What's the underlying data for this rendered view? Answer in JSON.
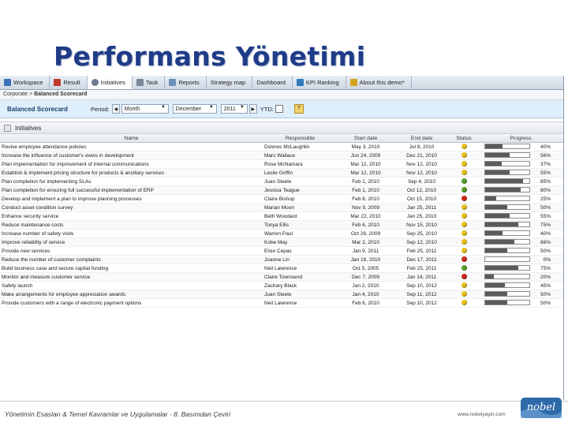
{
  "slide_title": "Performans Yönetimi",
  "tabs": [
    {
      "label": "Workspace",
      "active": false,
      "icon": "workspace-icon",
      "color": "#3b6fb6"
    },
    {
      "label": "Result",
      "active": false,
      "icon": "chart-icon",
      "color": "#c0392b"
    },
    {
      "label": "Initiatives",
      "active": true,
      "icon": "gear-icon",
      "color": "#6b7d8f"
    },
    {
      "label": "Task",
      "active": false,
      "icon": "task-icon",
      "color": "#7a8899"
    },
    {
      "label": "Reports",
      "active": false,
      "icon": "report-icon",
      "color": "#6b8fb5"
    },
    {
      "label": "Strategy map",
      "active": false,
      "icon": "",
      "color": ""
    },
    {
      "label": "Dashboard",
      "active": false,
      "icon": "",
      "color": ""
    },
    {
      "label": "KPI Ranking",
      "active": false,
      "icon": "ranking-icon",
      "color": "#2e7bbd"
    },
    {
      "label": "About this demo*",
      "active": false,
      "icon": "star-icon",
      "color": "#d5a21c"
    }
  ],
  "breadcrumb": {
    "parent": "Corporate > ",
    "current": "Balanced Scorecard"
  },
  "filters": {
    "title": "Balanced Scorecard",
    "period_label": "Period:",
    "period_value": "Month",
    "month_value": "December",
    "year_value": "2011",
    "ytd_label": "YTD:"
  },
  "section_title": "Initiatives",
  "columns": [
    "Name",
    "Responsible",
    "Start date",
    "End date",
    "Status",
    "Progress"
  ],
  "status_colors": {
    "yellow": "#e8c21a",
    "green": "#5aa02c",
    "red": "#d2291e"
  },
  "rows": [
    {
      "name": "Revise employee attendance policies",
      "responsible": "Dolores McLaughlin",
      "start": "May 3, 2010",
      "end": "Jul 8, 2010",
      "status": "yellow",
      "progress": 40
    },
    {
      "name": "Increase the influence of customer's views in development",
      "responsible": "Marc Wallace",
      "start": "Jun 24, 2009",
      "end": "Dec 21, 2010",
      "status": "yellow",
      "progress": 56
    },
    {
      "name": "Plan implementation for improvement of internal communications",
      "responsible": "Rose McNamara",
      "start": "Mar 12, 2010",
      "end": "Nov 12, 2010",
      "status": "yellow",
      "progress": 37
    },
    {
      "name": "Establish & implement pricing structure for products & ancillary services",
      "responsible": "Leslie Griffin",
      "start": "Mar 12, 2010",
      "end": "Nov 12, 2010",
      "status": "yellow",
      "progress": 55
    },
    {
      "name": "Plan completion for implementing SLAs",
      "responsible": "Juan Steele",
      "start": "Feb 1, 2010",
      "end": "Sep 4, 2010",
      "status": "green",
      "progress": 85
    },
    {
      "name": "Plan completion for ensuring full successful implementation of ERP",
      "responsible": "Jessica Teague",
      "start": "Feb 1, 2010",
      "end": "Oct 12, 2010",
      "status": "green",
      "progress": 80
    },
    {
      "name": "Develop and implement a plan to improve planning processes",
      "responsible": "Claire Bishop",
      "start": "Feb 8, 2010",
      "end": "Oct 15, 2010",
      "status": "red",
      "progress": 25
    },
    {
      "name": "Conduct asset condition survey",
      "responsible": "Marian Moon",
      "start": "Nov 9, 2009",
      "end": "Jan 25, 2011",
      "status": "yellow",
      "progress": 50
    },
    {
      "name": "Enhance security service",
      "responsible": "Beth Woodard",
      "start": "Mar 22, 2010",
      "end": "Jan 25, 2010",
      "status": "yellow",
      "progress": 55
    },
    {
      "name": "Reduce maintenance costs",
      "responsible": "Tonya Ellis",
      "start": "Feb 6, 2010",
      "end": "Nov 15, 2010",
      "status": "yellow",
      "progress": 75
    },
    {
      "name": "Increase number of safety visits",
      "responsible": "Warren Paul",
      "start": "Oct 26, 2009",
      "end": "Sep 25, 2010",
      "status": "yellow",
      "progress": 40
    },
    {
      "name": "Improve reliability of service",
      "responsible": "Kobe May",
      "start": "Mar 2, 2010",
      "end": "Sep 12, 2010",
      "status": "yellow",
      "progress": 66
    },
    {
      "name": "Provide new services",
      "responsible": "Elsie Cepas",
      "start": "Jan 9, 2011",
      "end": "Feb 25, 2011",
      "status": "yellow",
      "progress": 50
    },
    {
      "name": "Reduce the number of customer complaints",
      "responsible": "Joanne Lin",
      "start": "Jan 18, 2010",
      "end": "Dec 17, 2011",
      "status": "red",
      "progress": 0
    },
    {
      "name": "Build business case and secure capital funding",
      "responsible": "Neil Lawrence",
      "start": "Oct 5, 2005",
      "end": "Feb 25, 2011",
      "status": "green",
      "progress": 75
    },
    {
      "name": "Monitor and measure customer service",
      "responsible": "Claire Townsend",
      "start": "Dec 7, 2009",
      "end": "Jan 14, 2011",
      "status": "red",
      "progress": 20
    },
    {
      "name": "Safety launch",
      "responsible": "Zachary Black",
      "start": "Jan 2, 2010",
      "end": "Sep 10, 2012",
      "status": "yellow",
      "progress": 45
    },
    {
      "name": "Make arrangements for employee appreciation awards",
      "responsible": "Juan Steele",
      "start": "Jan 4, 2010",
      "end": "Sep 11, 2012",
      "status": "yellow",
      "progress": 50
    },
    {
      "name": "Provide customers with a range of electronic payment options",
      "responsible": "Neil Lawrence",
      "start": "Feb 6, 2010",
      "end": "Sep 10, 2012",
      "status": "yellow",
      "progress": 50
    }
  ],
  "footer": {
    "text": "Yönetimin Esasları & Temel Kavramlar ve Uygulamalar - 8. Basımdan Çeviri",
    "url": "www.nobelyayin.com",
    "logo_text": "nobel",
    "logo_color": "#2f6aa8"
  }
}
